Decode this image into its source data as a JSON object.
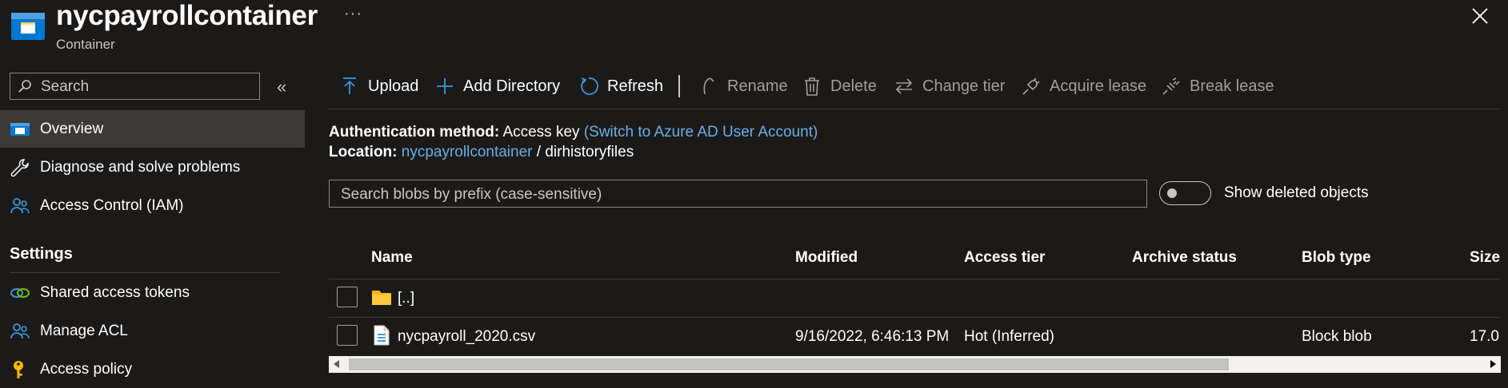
{
  "header": {
    "title": "nycpayrollcontainer",
    "subtitle": "Container",
    "more": "···"
  },
  "sidebar": {
    "search_placeholder": "Search",
    "collapse": "«",
    "items": [
      {
        "label": "Overview",
        "icon": "container-icon",
        "selected": true
      },
      {
        "label": "Diagnose and solve problems",
        "icon": "wrench-icon"
      },
      {
        "label": "Access Control (IAM)",
        "icon": "people-icon"
      }
    ],
    "settings_heading": "Settings",
    "settings_items": [
      {
        "label": "Shared access tokens",
        "icon": "link-icon"
      },
      {
        "label": "Manage ACL",
        "icon": "people-icon"
      },
      {
        "label": "Access policy",
        "icon": "key-icon"
      }
    ]
  },
  "toolbar": {
    "upload": "Upload",
    "add_directory": "Add Directory",
    "refresh": "Refresh",
    "rename": "Rename",
    "delete": "Delete",
    "change_tier": "Change tier",
    "acquire_lease": "Acquire lease",
    "break_lease": "Break lease"
  },
  "info": {
    "auth_label": "Authentication method:",
    "auth_value": "Access key",
    "auth_link": "(Switch to Azure AD User Account)",
    "location_label": "Location:",
    "location_link": "nycpayrollcontainer",
    "location_sep": "/",
    "location_path": "dirhistoryfiles"
  },
  "blob_search": {
    "placeholder": "Search blobs by prefix (case-sensitive)",
    "show_deleted_label": "Show deleted objects",
    "show_deleted": false
  },
  "table": {
    "columns": [
      "Name",
      "Modified",
      "Access tier",
      "Archive status",
      "Blob type",
      "Size"
    ],
    "rows": [
      {
        "name": "[..]",
        "icon": "folder-icon",
        "modified": "",
        "access_tier": "",
        "archive_status": "",
        "blob_type": "",
        "size": ""
      },
      {
        "name": "nycpayroll_2020.csv",
        "icon": "file-icon",
        "modified": "9/16/2022, 6:46:13 PM",
        "access_tier": "Hot (Inferred)",
        "archive_status": "",
        "blob_type": "Block blob",
        "size": "17.0"
      }
    ]
  },
  "colors": {
    "background": "#1b1a19",
    "link": "#69afe5",
    "accent": "#0078d4",
    "selected": "#3b3a39"
  }
}
